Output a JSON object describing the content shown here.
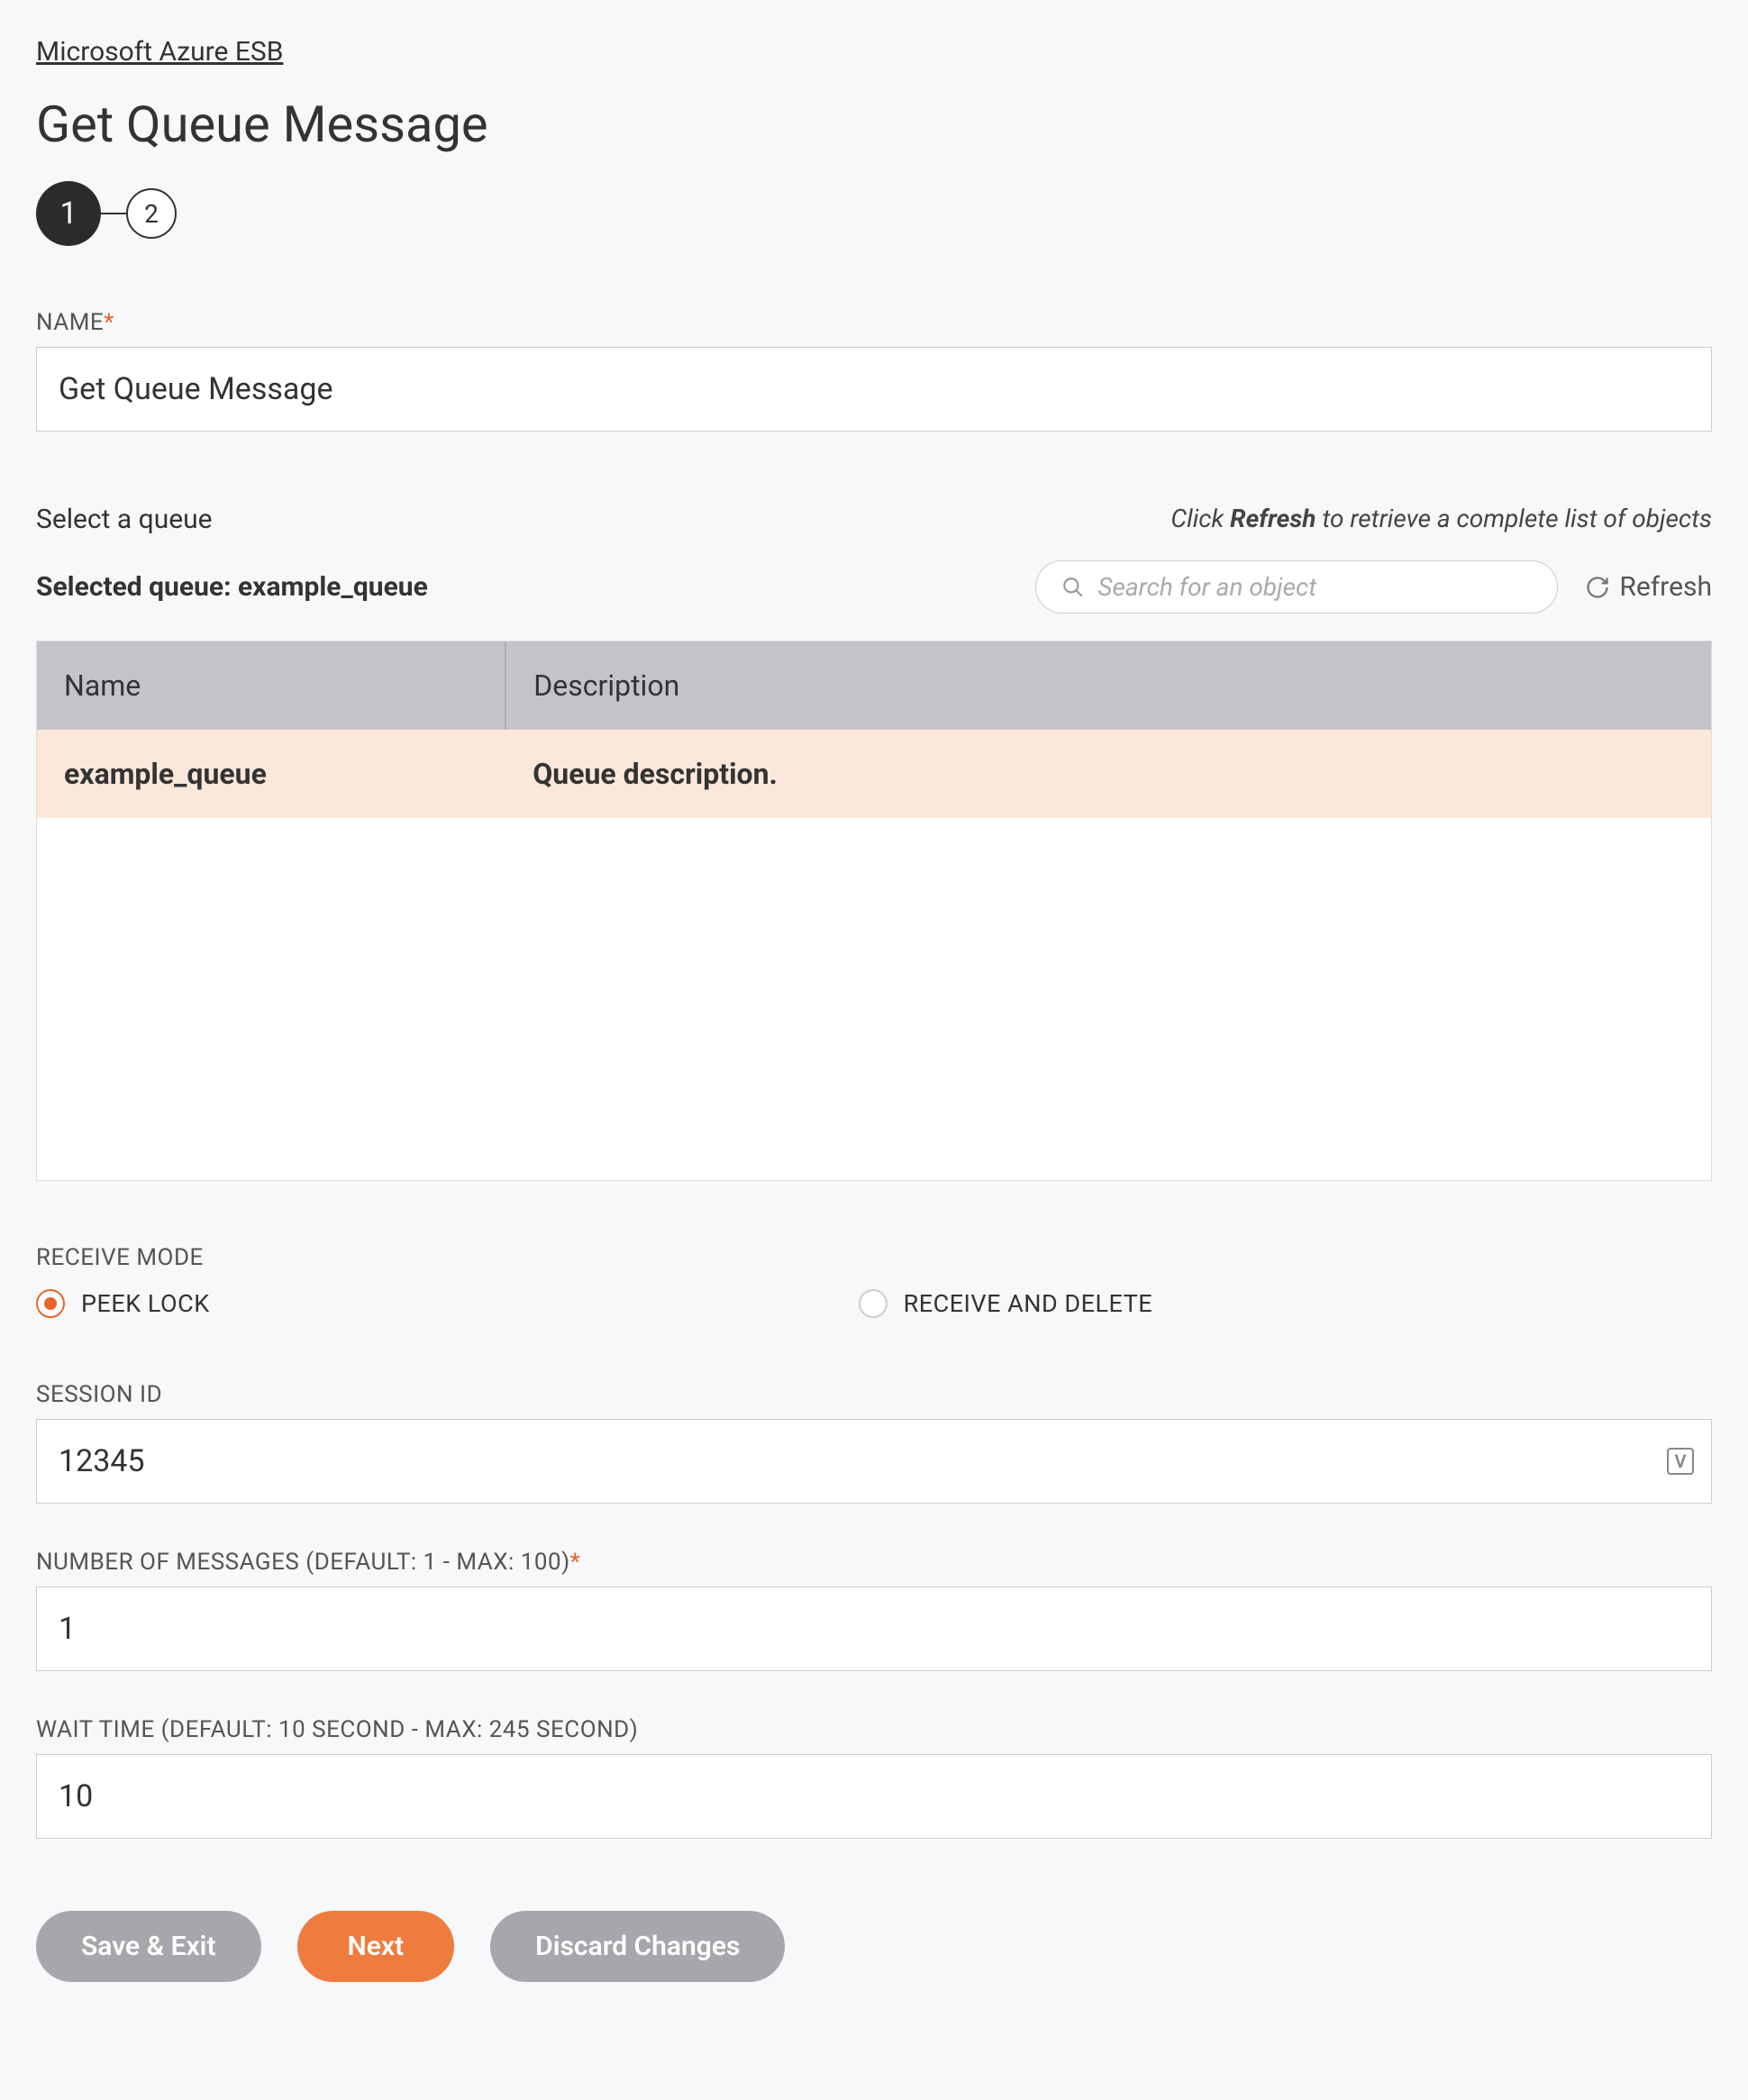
{
  "breadcrumb": "Microsoft Azure ESB",
  "page_title": "Get Queue Message",
  "stepper": {
    "step1": "1",
    "step2": "2"
  },
  "fields": {
    "name": {
      "label": "NAME",
      "value": "Get Queue Message"
    },
    "receive_mode": {
      "label": "RECEIVE MODE",
      "option_peek": "PEEK LOCK",
      "option_receive": "RECEIVE AND DELETE"
    },
    "session_id": {
      "label": "SESSION ID",
      "value": "12345"
    },
    "num_messages": {
      "label": "NUMBER OF MESSAGES (DEFAULT: 1 - MAX: 100)",
      "value": "1"
    },
    "wait_time": {
      "label": "WAIT TIME (DEFAULT: 10 SECOND - MAX: 245 SECOND)",
      "value": "10"
    }
  },
  "queue_section": {
    "select_label": "Select a queue",
    "hint_pre": "Click ",
    "hint_bold": "Refresh",
    "hint_post": " to retrieve a complete list of objects",
    "selected_prefix": "Selected queue: ",
    "selected_value": "example_queue",
    "search_placeholder": "Search for an object",
    "refresh_label": "Refresh",
    "columns": {
      "name": "Name",
      "description": "Description"
    },
    "rows": [
      {
        "name": "example_queue",
        "description": "Queue description."
      }
    ]
  },
  "buttons": {
    "save_exit": "Save & Exit",
    "next": "Next",
    "discard": "Discard Changes"
  }
}
